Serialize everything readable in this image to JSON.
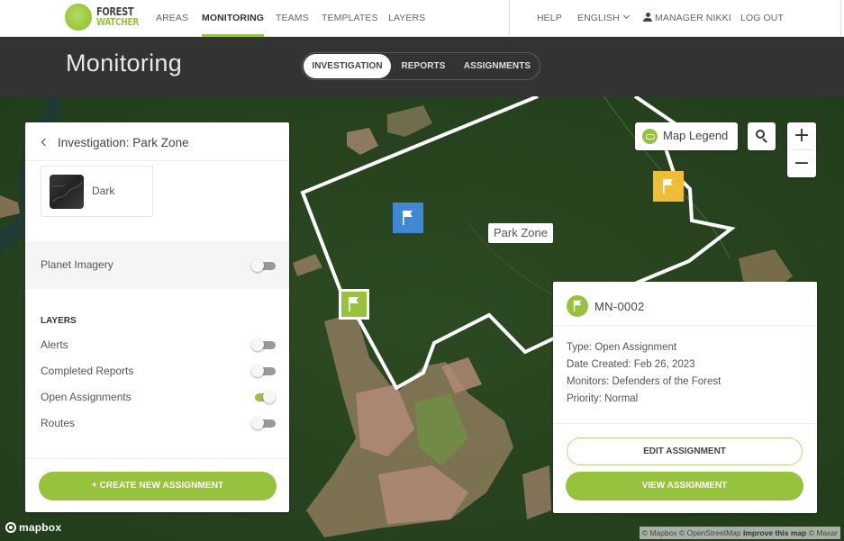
{
  "brand": {
    "line1": "FOREST",
    "line2": "WATCHER",
    "accent_color": "#97c23d"
  },
  "nav": {
    "items": [
      {
        "label": "AREAS",
        "active": false
      },
      {
        "label": "MONITORING",
        "active": true
      },
      {
        "label": "TEAMS",
        "active": false
      },
      {
        "label": "TEMPLATES",
        "active": false
      },
      {
        "label": "LAYERS",
        "active": false
      }
    ],
    "help": "HELP",
    "language": "ENGLISH",
    "language_icon": "chevron-down-icon",
    "user": "MANAGER NIKKI",
    "user_icon": "user-icon",
    "logout": "LOG OUT"
  },
  "header": {
    "title": "Monitoring",
    "tabs": [
      {
        "label": "INVESTIGATION",
        "active": true
      },
      {
        "label": "REPORTS",
        "active": false
      },
      {
        "label": "ASSIGNMENTS",
        "active": false
      }
    ]
  },
  "panel": {
    "title": "Investigation: Park Zone",
    "back_icon": "chevron-left-icon",
    "basemap": {
      "label": "Dark"
    },
    "planet_imagery": {
      "label": "Planet Imagery",
      "enabled": false
    },
    "layers_heading": "LAYERS",
    "layers": [
      {
        "label": "Alerts",
        "enabled": false
      },
      {
        "label": "Completed Reports",
        "enabled": false
      },
      {
        "label": "Open Assignments",
        "enabled": true
      },
      {
        "label": "Routes",
        "enabled": false
      }
    ],
    "create_button": "+ CREATE NEW ASSIGNMENT"
  },
  "map": {
    "area_label": "Park Zone",
    "legend_button": "Map Legend",
    "legend_icon": "legend-icon",
    "search_icon": "search-icon",
    "zoom_in": "+",
    "zoom_out": "−",
    "markers": [
      {
        "name": "blue-flag-marker",
        "color": "#3f88d6",
        "icon": "flag-icon"
      },
      {
        "name": "yellow-flag-marker",
        "color": "#f0be35",
        "icon": "flag-icon"
      },
      {
        "name": "green-flag-marker",
        "color": "#97c23d",
        "icon": "flag-icon",
        "selected": true
      }
    ],
    "mapbox_logo": "mapbox",
    "attribution": {
      "mapbox": "© Mapbox",
      "osm": "© OpenStreetMap",
      "improve": "Improve this map",
      "maxar": "© Maxar"
    }
  },
  "popup": {
    "title": "MN-0002",
    "icon": "flag-icon",
    "details": [
      "Type: Open Assignment",
      "Date Created: Feb 26, 2023",
      "Monitors: Defenders of the Forest",
      "Priority: Normal"
    ],
    "edit_button": "EDIT ASSIGNMENT",
    "view_button": "VIEW ASSIGNMENT"
  }
}
